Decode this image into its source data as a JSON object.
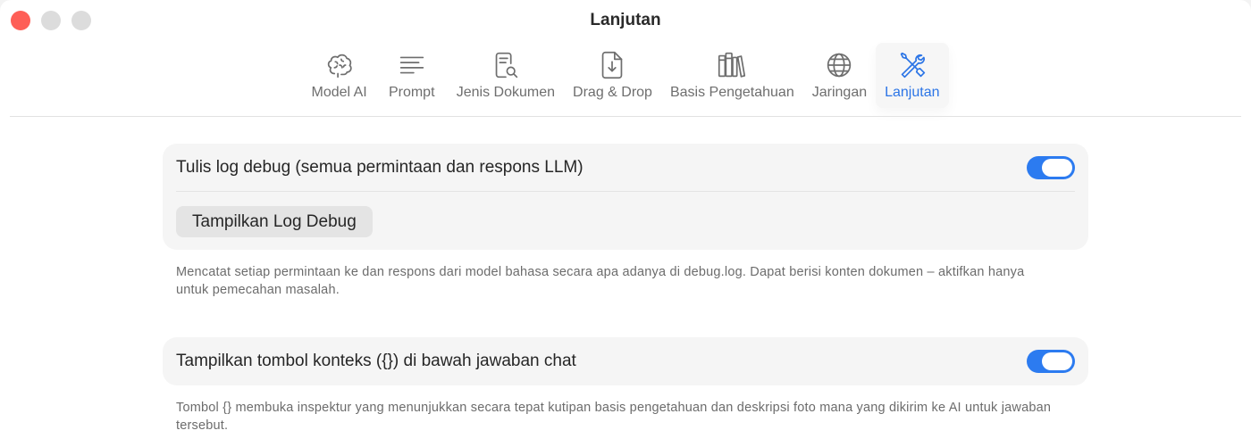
{
  "window": {
    "title": "Lanjutan",
    "traffic_lights": [
      "close",
      "minimize",
      "zoom"
    ],
    "colors": {
      "close": "#fe5f57",
      "inactive": "#dcdcdc",
      "accent": "#2c7bf0"
    }
  },
  "toolbar": {
    "items": [
      {
        "label": "Model AI",
        "icon": "brain-icon",
        "active": false
      },
      {
        "label": "Prompt",
        "icon": "text-lines-icon",
        "active": false
      },
      {
        "label": "Jenis Dokumen",
        "icon": "document-search-icon",
        "active": false
      },
      {
        "label": "Drag & Drop",
        "icon": "document-download-icon",
        "active": false
      },
      {
        "label": "Basis Pengetahuan",
        "icon": "books-icon",
        "active": false
      },
      {
        "label": "Jaringan",
        "icon": "globe-icon",
        "active": false
      },
      {
        "label": "Lanjutan",
        "icon": "wrench-screwdriver-icon",
        "active": true
      }
    ]
  },
  "settings": {
    "debug_log": {
      "label": "Tulis log debug (semua permintaan dan respons LLM)",
      "enabled": true,
      "button_label": "Tampilkan Log Debug",
      "description": "Mencatat setiap permintaan ke dan respons dari model bahasa secara apa adanya di debug.log. Dapat berisi konten dokumen – aktifkan hanya untuk pemecahan masalah."
    },
    "context_button": {
      "label": "Tampilkan tombol konteks ({}) di bawah jawaban chat",
      "enabled": true,
      "description": "Tombol {} membuka inspektur yang menunjukkan secara tepat kutipan basis pengetahuan dan deskripsi foto mana yang dikirim ke AI untuk jawaban tersebut."
    }
  }
}
